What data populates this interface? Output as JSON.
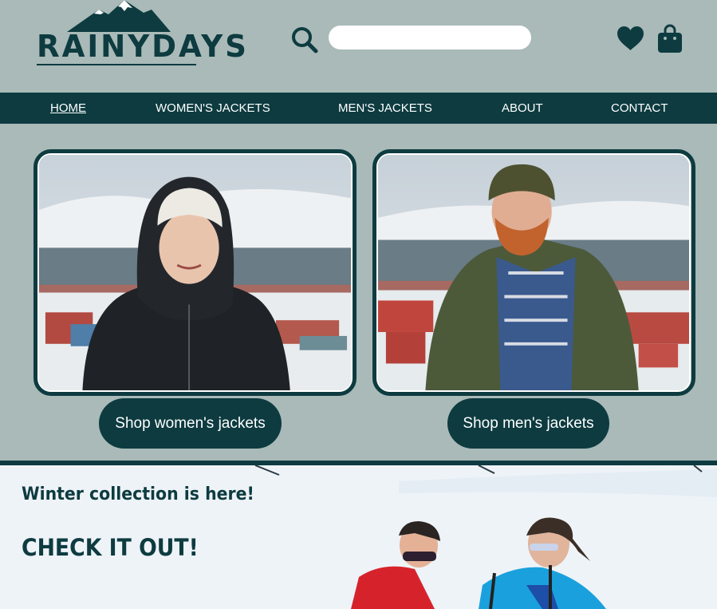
{
  "brand": {
    "name": "RAINYDAYS",
    "logo_icon": "mountain-icon"
  },
  "search": {
    "placeholder": "",
    "value": ""
  },
  "icons": {
    "search": "search-icon",
    "favorites": "heart-icon",
    "cart": "shopping-bag-icon"
  },
  "nav": {
    "items": [
      {
        "label": "HOME",
        "active": true
      },
      {
        "label": "WOMEN'S JACKETS",
        "active": false
      },
      {
        "label": "MEN'S JACKETS",
        "active": false
      },
      {
        "label": "ABOUT",
        "active": false
      },
      {
        "label": "CONTACT",
        "active": false
      }
    ]
  },
  "cards": [
    {
      "button_label": "Shop women's jackets"
    },
    {
      "button_label": "Shop men's jackets"
    }
  ],
  "hero": {
    "subtitle": "Winter collection is here!",
    "title": "CHECK IT OUT!"
  },
  "colors": {
    "background": "#a9bab8",
    "primary": "#0d3b40",
    "white": "#ffffff"
  }
}
